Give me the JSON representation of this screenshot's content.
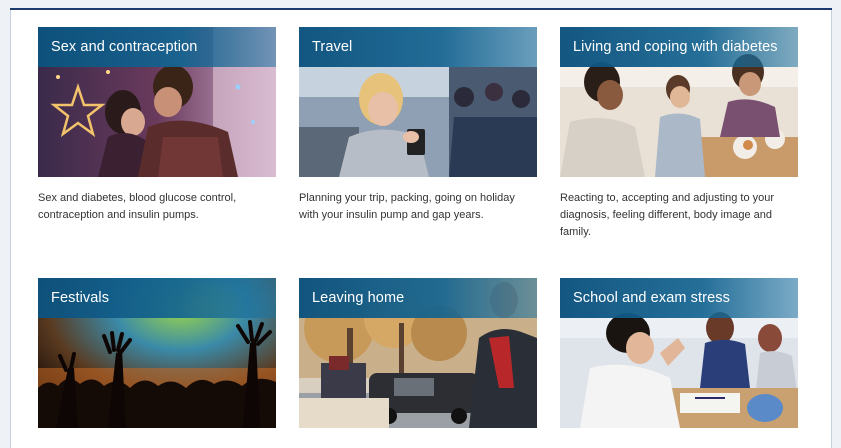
{
  "cards": [
    {
      "title": "Sex and contraception",
      "description": "Sex and diabetes, blood glucose control, contraception and insulin pumps."
    },
    {
      "title": "Travel",
      "description": "Planning your trip, packing, going on holiday with your insulin pump and gap years."
    },
    {
      "title": "Living and coping with diabetes",
      "description": "Reacting to, accepting and adjusting to your diagnosis, feeling different, body image and family."
    },
    {
      "title": "Festivals",
      "description": ""
    },
    {
      "title": "Leaving home",
      "description": ""
    },
    {
      "title": "School and exam stress",
      "description": ""
    }
  ],
  "colors": {
    "title_bar": "#0c527e",
    "frame_border": "#1d3a6e"
  }
}
